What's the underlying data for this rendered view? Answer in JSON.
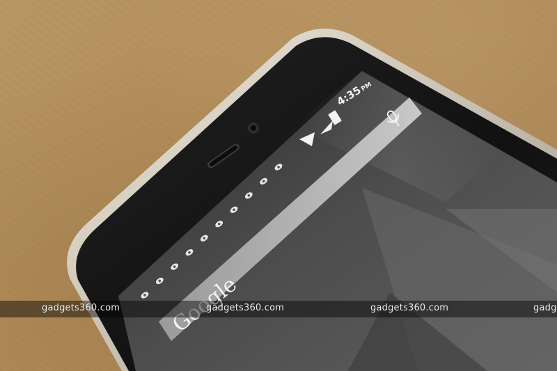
{
  "status_bar": {
    "time": "4:35",
    "ampm": "PM",
    "icons": [
      "wifi-icon",
      "cell-signal-icon",
      "battery-icon"
    ]
  },
  "search_bar": {
    "logo_text": "Google",
    "icons": [
      "microphone-icon"
    ]
  },
  "page_indicator": {
    "icon": "eye-dot-icon",
    "count": 10
  },
  "watermark": {
    "text_1": "gadgets360.com",
    "text_2": "gadgets360.com",
    "text_3": "gadgets360.com",
    "text_4": "gadg"
  },
  "colors": {
    "desk": "#b08a56",
    "phone_frame": "#d8d2c6",
    "bezel": "#141414",
    "screen": "#4a4a4a",
    "search_bar": "#bdbdbd"
  }
}
